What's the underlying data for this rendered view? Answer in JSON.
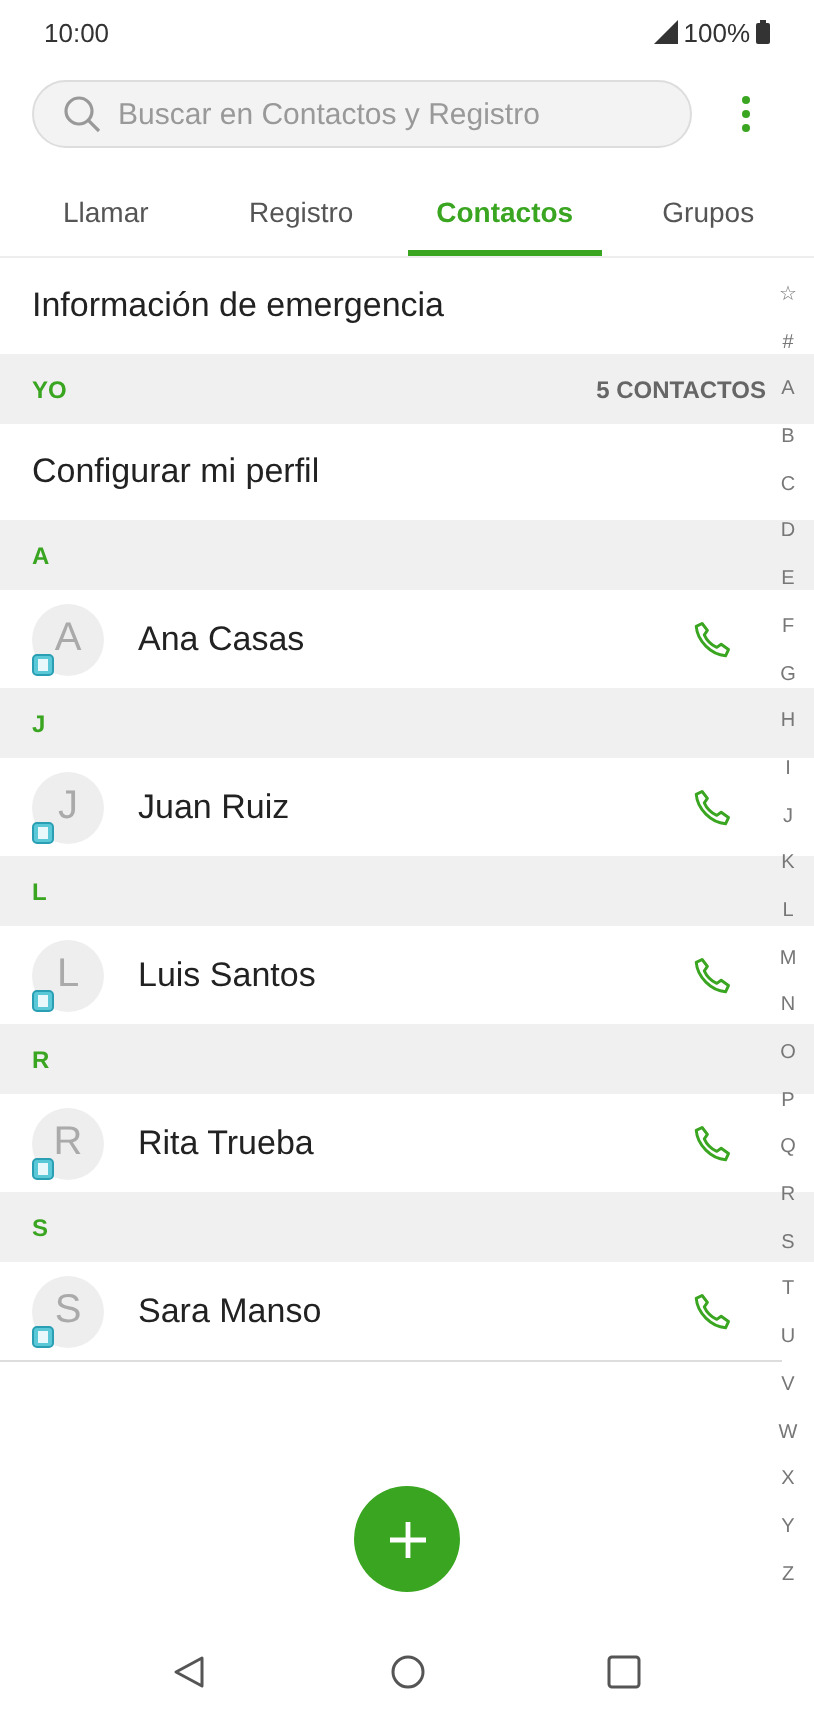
{
  "status_bar": {
    "time": "10:00",
    "battery": "100%"
  },
  "search": {
    "placeholder": "Buscar en Contactos y Registro"
  },
  "tabs": [
    {
      "label": "Llamar",
      "selected": false
    },
    {
      "label": "Registro",
      "selected": false
    },
    {
      "label": "Contactos",
      "selected": true
    },
    {
      "label": "Grupos",
      "selected": false
    }
  ],
  "emergency": "Información de emergencia",
  "me_section": {
    "header": "YO",
    "count": "5 CONTACTOS",
    "profile": "Configurar mi perfil"
  },
  "sections": [
    {
      "letter": "A",
      "contacts": [
        {
          "avatar": "A",
          "name": "Ana Casas"
        }
      ]
    },
    {
      "letter": "J",
      "contacts": [
        {
          "avatar": "J",
          "name": "Juan Ruiz"
        }
      ]
    },
    {
      "letter": "L",
      "contacts": [
        {
          "avatar": "L",
          "name": "Luis Santos"
        }
      ]
    },
    {
      "letter": "R",
      "contacts": [
        {
          "avatar": "R",
          "name": "Rita Trueba"
        }
      ]
    },
    {
      "letter": "S",
      "contacts": [
        {
          "avatar": "S",
          "name": "Sara Manso"
        }
      ]
    }
  ],
  "index": [
    "☆",
    "#",
    "A",
    "B",
    "C",
    "D",
    "E",
    "F",
    "G",
    "H",
    "I",
    "J",
    "K",
    "L",
    "M",
    "N",
    "O",
    "P",
    "Q",
    "R",
    "S",
    "T",
    "U",
    "V",
    "W",
    "X",
    "Y",
    "Z"
  ]
}
